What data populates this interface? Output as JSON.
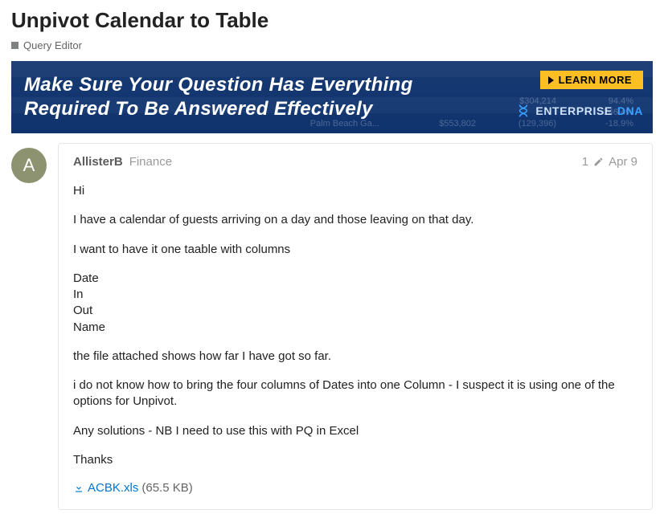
{
  "title": "Unpivot Calendar to Table",
  "category": "Query Editor",
  "banner": {
    "headline": "Make Sure Your Question Has Everything Required To Be Answered Effectively",
    "cta_label": "LEARN MORE",
    "brand_prefix": "ENTERPRISE",
    "brand_suffix": "DNA",
    "bg_nums": {
      "n1": "$304,214",
      "n2": "94.4%",
      "n3": "246.4%",
      "n4": "$553,802",
      "n5": "(129,396)",
      "n6": "-18.9%",
      "n7": "Palm Beach Ga..."
    }
  },
  "post": {
    "author": "AllisterB",
    "author_tag": "Finance",
    "edit_count": "1",
    "date": "Apr 9",
    "avatar_letter": "A",
    "p1": "Hi",
    "p2": "I have a calendar of guests arriving on a day and those leaving on that day.",
    "p3": "I want to have it one taable with columns",
    "col1": "Date",
    "col2": "In",
    "col3": "Out",
    "col4": "Name",
    "p4": "the file attached shows how far I have got so far.",
    "p5": "i do not know how to bring the four columns of Dates into one Column - I suspect it is using one of the options for Unpivot.",
    "p6": "Any solutions - NB I need to use this with PQ in Excel",
    "p7": "Thanks",
    "attachment_name": "ACBK.xls",
    "attachment_size": "(65.5 KB)"
  }
}
